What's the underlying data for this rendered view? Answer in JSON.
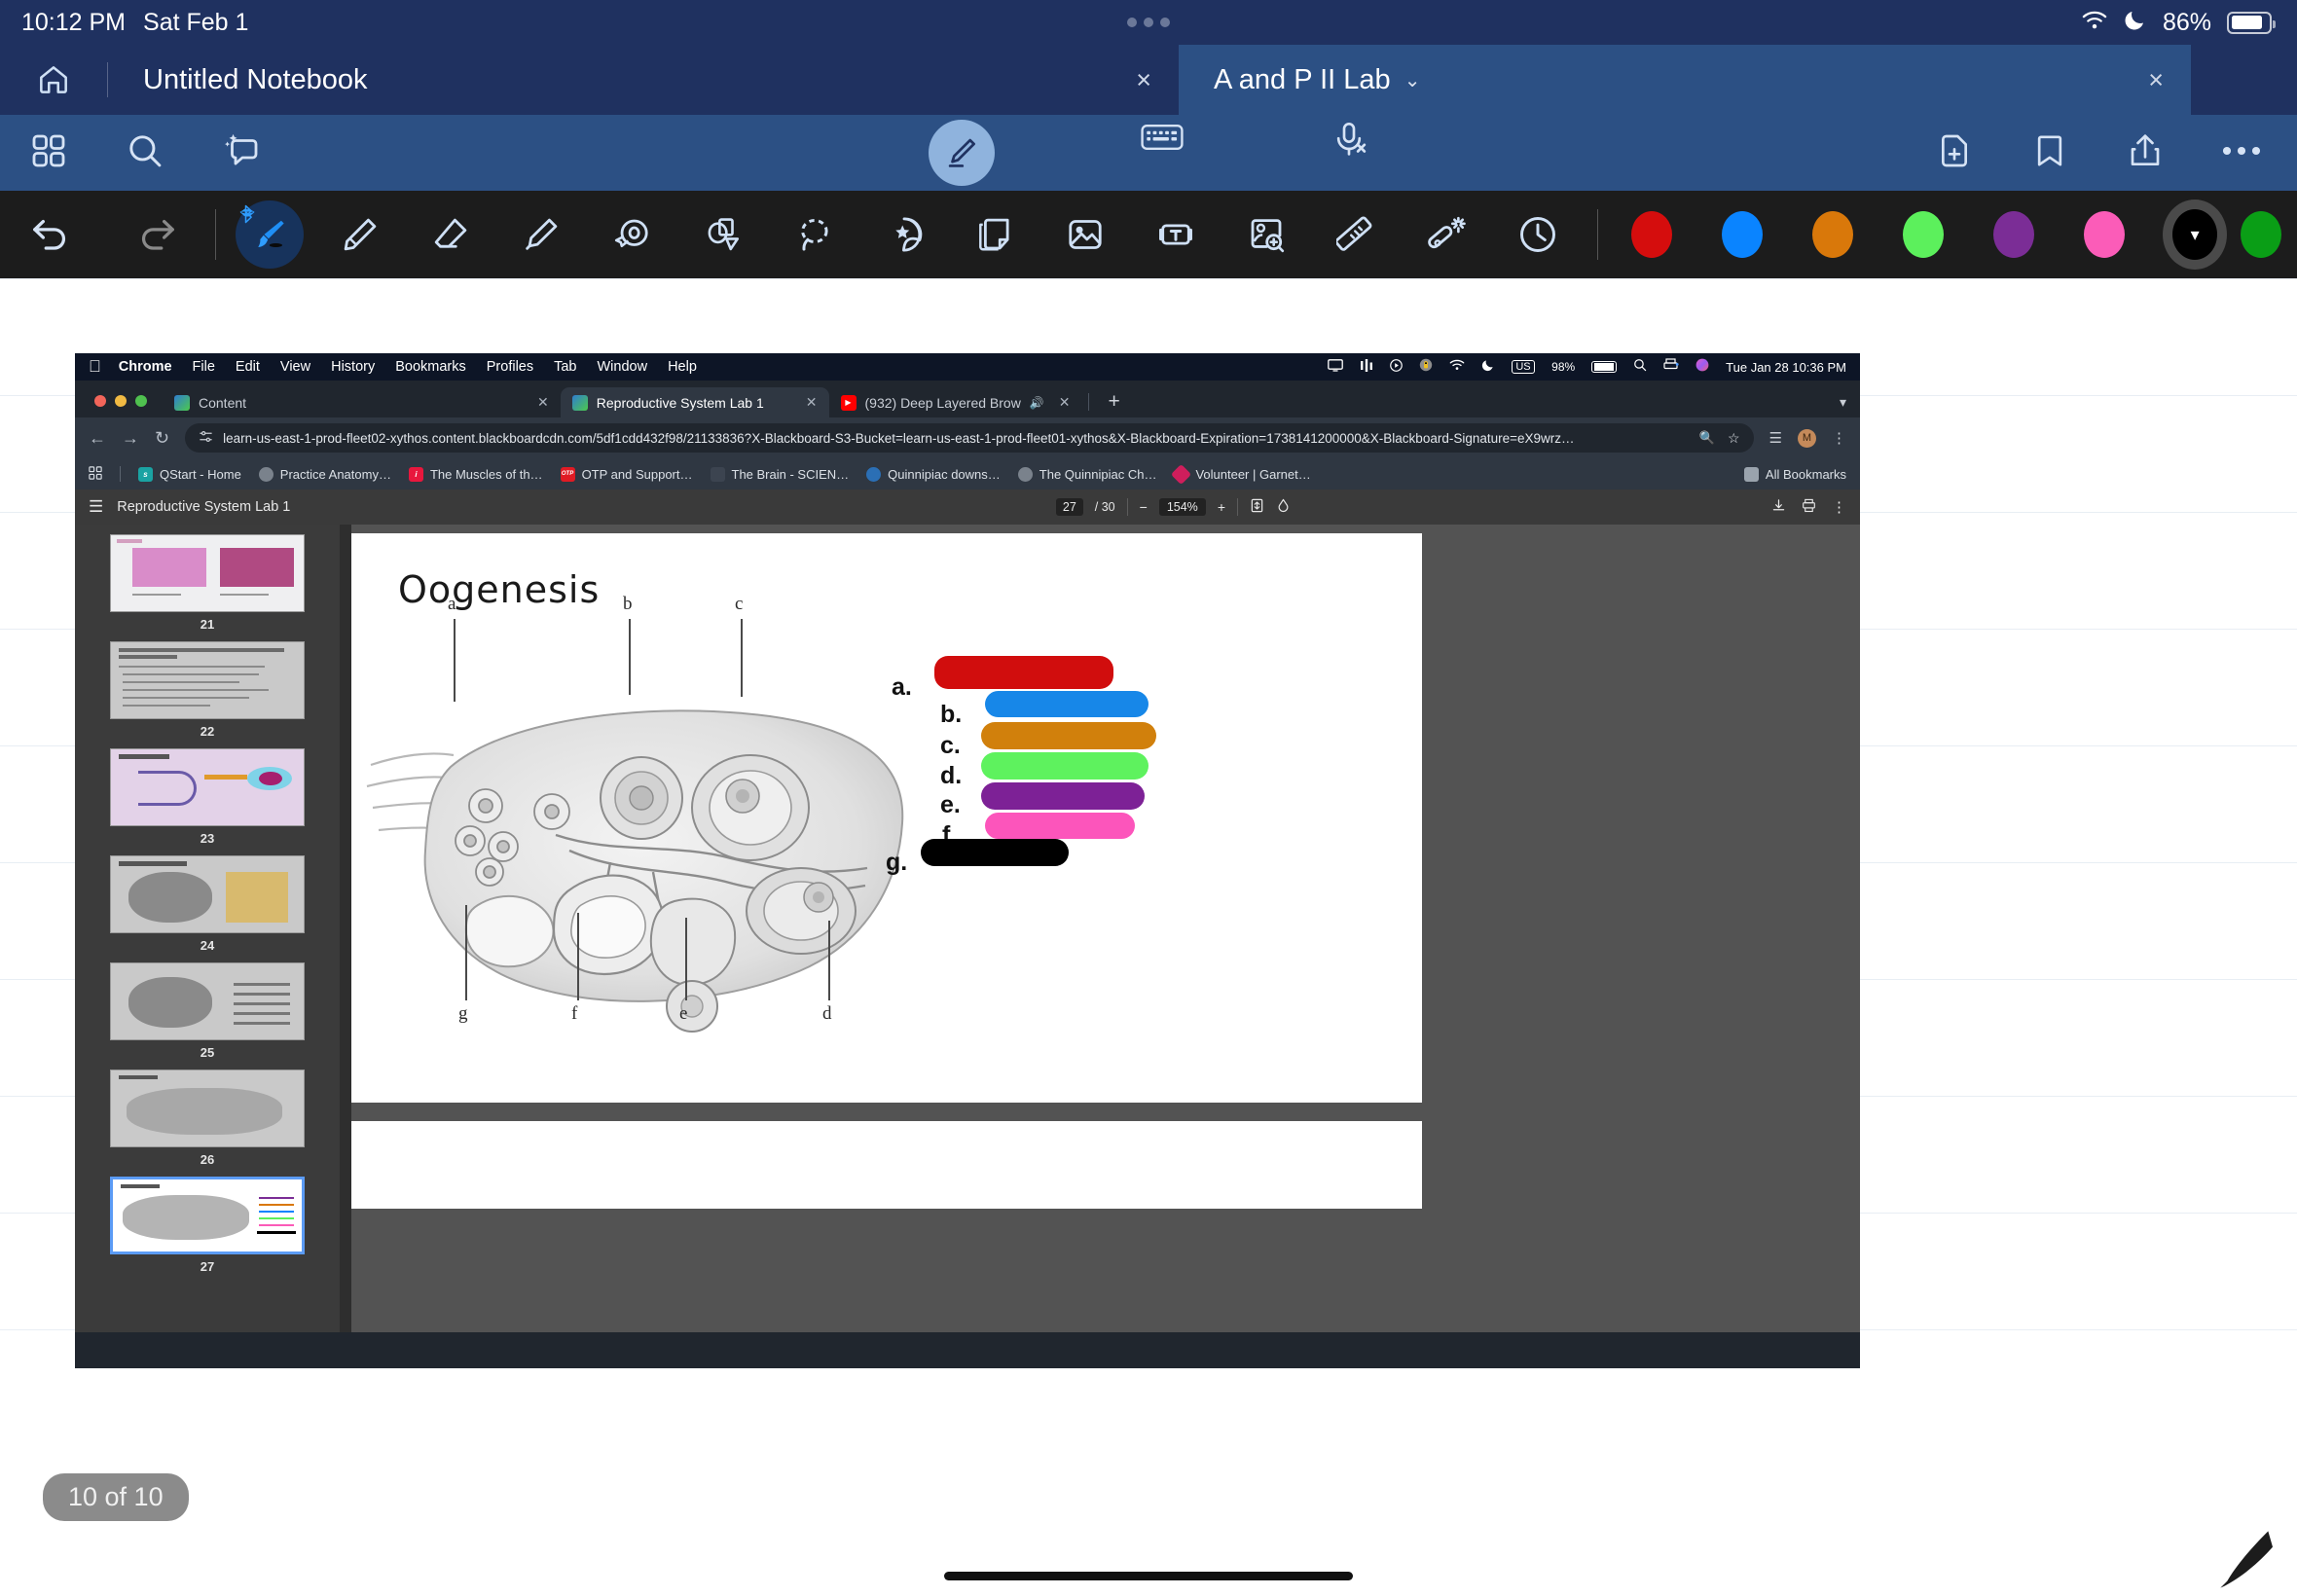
{
  "status_bar": {
    "time": "10:12 PM",
    "date": "Sat Feb 1",
    "wifi_icon": "wifi-icon",
    "moon_icon": "moon-icon",
    "battery_percent": "86%",
    "battery_level": 86
  },
  "notebook_tabs": {
    "home_icon": "home-icon",
    "tabs": [
      {
        "label": "Untitled Notebook",
        "close": "×",
        "active": false
      },
      {
        "label": "A and P II Lab",
        "chevron": "⌄",
        "close": "×",
        "active": true
      }
    ]
  },
  "action_bar": {
    "left": [
      {
        "name": "grid-view-icon",
        "label": "Grid"
      },
      {
        "name": "search-icon",
        "label": "Search"
      },
      {
        "name": "ai-assist-icon",
        "label": "AI Assist"
      }
    ],
    "center": [
      {
        "name": "pen-mode-icon",
        "label": "Pen"
      },
      {
        "name": "keyboard-icon",
        "label": "Keyboard"
      },
      {
        "name": "microphone-off-icon",
        "label": "Microphone Off"
      }
    ],
    "right": [
      {
        "name": "add-page-icon",
        "label": "Add Page"
      },
      {
        "name": "bookmark-icon",
        "label": "Bookmark"
      },
      {
        "name": "share-icon",
        "label": "Share"
      },
      {
        "name": "more-options-icon",
        "label": "More"
      }
    ]
  },
  "toolbar": {
    "undo": "undo-icon",
    "redo": "redo-icon",
    "tools": [
      {
        "name": "brush-tool",
        "label": "Brush",
        "active": true
      },
      {
        "name": "pencil-tool",
        "label": "Pencil",
        "active": false
      },
      {
        "name": "eraser-tool",
        "label": "Eraser",
        "active": false
      },
      {
        "name": "highlighter-tool",
        "label": "Highlighter",
        "active": false
      },
      {
        "name": "tape-tool",
        "label": "Washi Tape",
        "active": false
      },
      {
        "name": "shapes-tool",
        "label": "Shapes",
        "active": false
      },
      {
        "name": "lasso-tool",
        "label": "Lasso Select",
        "active": false
      },
      {
        "name": "sticker-tool",
        "label": "Sticker",
        "active": false
      },
      {
        "name": "sticky-note-tool",
        "label": "Sticky Note",
        "active": false
      },
      {
        "name": "image-tool",
        "label": "Image",
        "active": false
      },
      {
        "name": "text-box-tool",
        "label": "Text Box",
        "active": false
      },
      {
        "name": "snip-tool",
        "label": "Screenshot Snip",
        "active": false
      },
      {
        "name": "ruler-tool",
        "label": "Ruler",
        "active": false
      },
      {
        "name": "magic-wand-tool",
        "label": "Magic Wand",
        "active": false
      },
      {
        "name": "history-tool",
        "label": "History",
        "active": false
      }
    ],
    "colors": [
      {
        "name": "color-red",
        "hex": "#d50d0d",
        "selected": false
      },
      {
        "name": "color-blue",
        "hex": "#0a84ff",
        "selected": false
      },
      {
        "name": "color-orange",
        "hex": "#d9780a",
        "selected": false
      },
      {
        "name": "color-green",
        "hex": "#5cf05c",
        "selected": false
      },
      {
        "name": "color-purple",
        "hex": "#7b2d96",
        "selected": false
      },
      {
        "name": "color-pink",
        "hex": "#fb5cb8",
        "selected": false
      },
      {
        "name": "color-black",
        "hex": "#000000",
        "selected": true
      },
      {
        "name": "color-dark-green",
        "hex": "#0a9e16",
        "selected": false
      }
    ]
  },
  "screenshot": {
    "mac_menu_bar": {
      "apple": "",
      "items": [
        "Chrome",
        "File",
        "Edit",
        "View",
        "History",
        "Bookmarks",
        "Profiles",
        "Tab",
        "Window",
        "Help"
      ],
      "right_icons": [
        "display-icon",
        "equalizer-icon",
        "play-icon",
        "lock-icon",
        "wifi-icon",
        "moon-icon"
      ],
      "keyboard_layout": "US",
      "battery_percent": "98%",
      "search_icon": "search-icon",
      "printer_icon": "printer-icon",
      "siri_icon": "siri-icon",
      "date_time": "Tue Jan 28  10:36 PM"
    },
    "browser_tabs": [
      {
        "title": "Content",
        "favicon_color": "#2f7dd1",
        "active": false
      },
      {
        "title": "Reproductive System Lab 1",
        "favicon_color": "#2f7dd1",
        "active": true
      },
      {
        "title": "(932) Deep Layered Brow",
        "favicon_color": "#ff0000",
        "audio_icon": "speaker-icon",
        "active": false
      }
    ],
    "new_tab_label": "+",
    "omnibox": {
      "back_icon": "back-arrow-icon",
      "forward_icon": "forward-arrow-icon",
      "reload_icon": "reload-icon",
      "site_info_icon": "tune-icon",
      "url": "learn-us-east-1-prod-fleet02-xythos.content.blackboardcdn.com/5df1cdd432f98/21133836?X-Blackboard-S3-Bucket=learn-us-east-1-prod-fleet01-xythos&X-Blackboard-Expiration=1738141200000&X-Blackboard-Signature=eX9wrz…",
      "zoom_icon": "zoom-magnifier-icon",
      "bookmark_star_icon": "star-icon",
      "extensions_icon": "extensions-icon",
      "profile_initial": "M",
      "menu_icon": "kebab-menu-icon"
    },
    "bookmarks": [
      {
        "label": "QStart - Home",
        "color": "#1aa3a3"
      },
      {
        "label": "Practice Anatomy…",
        "color": "#9aa3ad"
      },
      {
        "label": "The Muscles of th…",
        "color": "#e8173d"
      },
      {
        "label": "OTP and Support…",
        "color": "#e01b24",
        "text": "OTP"
      },
      {
        "label": "The Brain - SCIEN…",
        "color": "#3c4450"
      },
      {
        "label": "Quinnipiac downs…",
        "color": "#2b6fb5"
      },
      {
        "label": "The Quinnipiac Ch…",
        "color": "#9aa3ad"
      },
      {
        "label": "Volunteer | Garnet…",
        "color": "#cf1e5c"
      }
    ],
    "all_bookmarks_label": "All Bookmarks",
    "pdf_toolbar": {
      "menu_icon": "hamburger-menu-icon",
      "doc_title": "Reproductive System Lab 1",
      "current_page": "27",
      "total_pages": "/ 30",
      "zoom_out": "−",
      "zoom_level": "154%",
      "zoom_in": "+",
      "fit_icon": "fit-page-icon",
      "rotate_icon": "rotate-icon",
      "download_icon": "download-icon",
      "print_icon": "print-icon",
      "more_icon": "kebab-menu-icon"
    },
    "thumbnails": [
      {
        "page": "21",
        "selected": false
      },
      {
        "page": "22",
        "selected": false
      },
      {
        "page": "23",
        "selected": false
      },
      {
        "page": "24",
        "selected": false
      },
      {
        "page": "25",
        "selected": false
      },
      {
        "page": "26",
        "selected": false
      },
      {
        "page": "27",
        "selected": true
      }
    ],
    "document": {
      "title": "Oogenesis",
      "diagram_labels_top": [
        "a",
        "b",
        "c"
      ],
      "diagram_labels_bottom": [
        "g",
        "f",
        "e",
        "d"
      ],
      "answer_key": [
        {
          "letter": "a.",
          "color": "#d10d0d",
          "name": "stroke-red"
        },
        {
          "letter": "b.",
          "color": "#1787e8",
          "name": "stroke-blue"
        },
        {
          "letter": "c.",
          "color": "#d1800c",
          "name": "stroke-orange"
        },
        {
          "letter": "d.",
          "color": "#5ef25e",
          "name": "stroke-green"
        },
        {
          "letter": "e.",
          "color": "#7d2196",
          "name": "stroke-purple"
        },
        {
          "letter": "f.",
          "color": "#fc55bb",
          "name": "stroke-pink"
        },
        {
          "letter": "g.",
          "color": "#000000",
          "name": "stroke-black"
        }
      ]
    }
  },
  "footer": {
    "page_indicator": "10 of 10"
  }
}
